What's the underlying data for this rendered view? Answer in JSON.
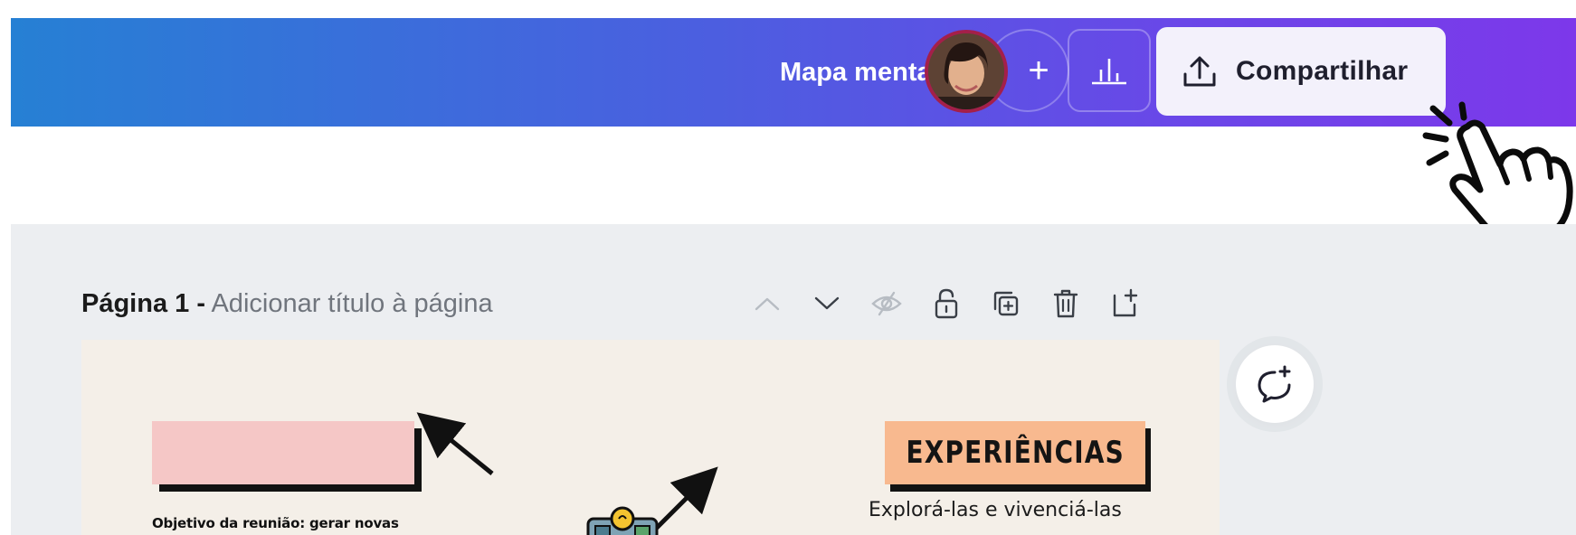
{
  "header": {
    "doc_title": "Mapa mental",
    "add_collaborator_label": "+",
    "share_label": "Compartilhar"
  },
  "icons": {
    "avatar": "avatar",
    "add": "plus-icon",
    "insights": "bar-chart-icon",
    "share": "upload-icon",
    "cursor": "hand-pointer-icon"
  },
  "page": {
    "number_label": "Página 1 -",
    "add_title_label": "Adicionar título à página",
    "tools": [
      "chevron-up-icon",
      "chevron-down-icon",
      "hide-icon",
      "lock-icon",
      "duplicate-icon",
      "trash-icon",
      "add-page-icon"
    ]
  },
  "canvas": {
    "objective_text": "Objetivo da reunião: gerar novas",
    "experiences_title": "EXPERIÊNCIAS",
    "experiences_subtitle": "Explorá-las e vivenciá-las"
  },
  "colors": {
    "gradient_start": "#2680d4",
    "gradient_end": "#7d38ea",
    "pink_card": "#f5c7c6",
    "orange_card": "#f8b98f",
    "canvas_bg": "#f4efe8",
    "workspace_bg": "#eceef1"
  }
}
